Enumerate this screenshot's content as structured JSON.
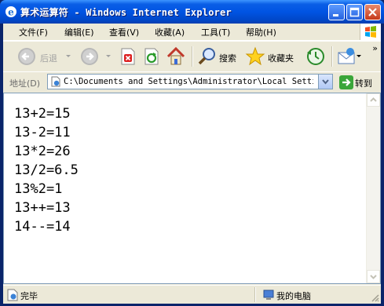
{
  "window": {
    "title": "算术运算符 - Windows Internet Explorer"
  },
  "menu": [
    "文件(F)",
    "编辑(E)",
    "查看(V)",
    "收藏(A)",
    "工具(T)",
    "帮助(H)"
  ],
  "toolbar": {
    "back_label": "后退",
    "search_label": "搜索",
    "favorites_label": "收藏夹",
    "more": "»"
  },
  "address": {
    "label": "地址(D)",
    "url": "C:\\Documents and Settings\\Administrator\\Local Settings\\Temp",
    "go_label": "转到"
  },
  "content": {
    "lines": [
      "13+2=15",
      "13-2=11",
      "13*2=26",
      "13/2=6.5",
      "13%2=1",
      "13++=13",
      "14--=14"
    ]
  },
  "status": {
    "text": "完毕",
    "zone": "我的电脑"
  },
  "colors": {
    "title_bar": "#0054e3",
    "chrome": "#ece9d8",
    "close_button": "#c5391a"
  }
}
